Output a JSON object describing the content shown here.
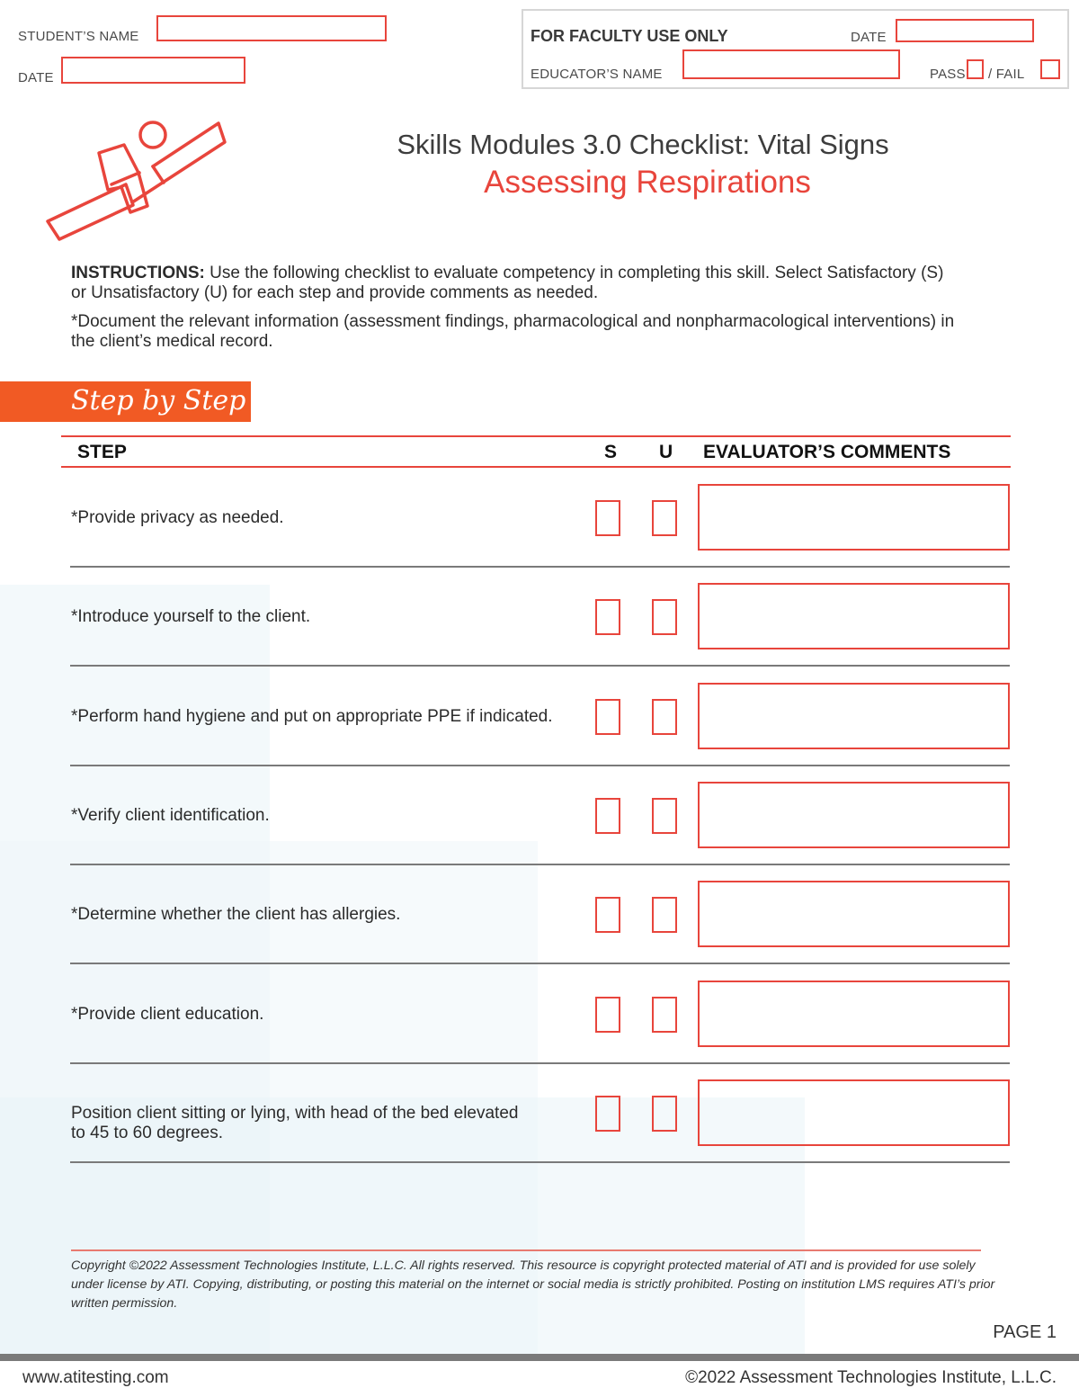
{
  "header": {
    "student_name_label": "STUDENT’S NAME",
    "date_label": "DATE",
    "student_name_value": "",
    "date_value": "",
    "faculty": {
      "title": "FOR FACULTY USE ONLY",
      "date_label": "DATE",
      "date_value": "",
      "educator_label": "EDUCATOR’S NAME",
      "educator_value": "",
      "pass_label": "PASS",
      "fail_label": "/ FAIL",
      "pass_checked": false,
      "fail_checked": false
    }
  },
  "title": {
    "main": "Skills Modules 3.0 Checklist: Vital Signs",
    "sub": "Assessing Respirations"
  },
  "instructions": {
    "lead": "INSTRUCTIONS:",
    "text": " Use the following checklist to evaluate competency in completing this skill. Select Satisfactory (S) or Unsatisfactory (U) for each step and provide comments as needed.",
    "note": "*Document the relevant information (assessment findings, pharmacological and nonpharmacological interventions) in the client’s medical record."
  },
  "section_banner": "Step by Step",
  "table": {
    "columns": [
      "STEP",
      "S",
      "U",
      "EVALUATOR’S COMMENTS"
    ],
    "rows": [
      {
        "step": "*Provide privacy as needed.",
        "s": false,
        "u": false,
        "comment": ""
      },
      {
        "step": "*Introduce yourself to the client.",
        "s": false,
        "u": false,
        "comment": ""
      },
      {
        "step": "*Perform hand hygiene and put on appropriate PPE if indicated.",
        "s": false,
        "u": false,
        "comment": ""
      },
      {
        "step": "*Verify client identification.",
        "s": false,
        "u": false,
        "comment": ""
      },
      {
        "step": "*Determine whether the client has allergies.",
        "s": false,
        "u": false,
        "comment": ""
      },
      {
        "step": "*Provide client education.",
        "s": false,
        "u": false,
        "comment": ""
      },
      {
        "step": "Position client sitting or lying, with head of the bed elevated to 45 to 60 degrees.",
        "s": false,
        "u": false,
        "comment": ""
      }
    ]
  },
  "footer": {
    "copyright": "Copyright ©2022 Assessment Technologies Institute, L.L.C. All rights reserved. This resource is copyright protected material of ATI and is provided for use solely under license by ATI.  Copying, distributing, or posting this material on the internet or social media is strictly prohibited.  Posting on institution LMS requires ATI’s prior written permission.",
    "page": "PAGE 1",
    "website": "www.atitesting.com",
    "company": "©2022 Assessment Technologies Institute, L.L.C."
  },
  "colors": {
    "accent_red": "#e8453c",
    "banner_orange": "#f15a24",
    "divider_gray": "#7a7a7a"
  }
}
